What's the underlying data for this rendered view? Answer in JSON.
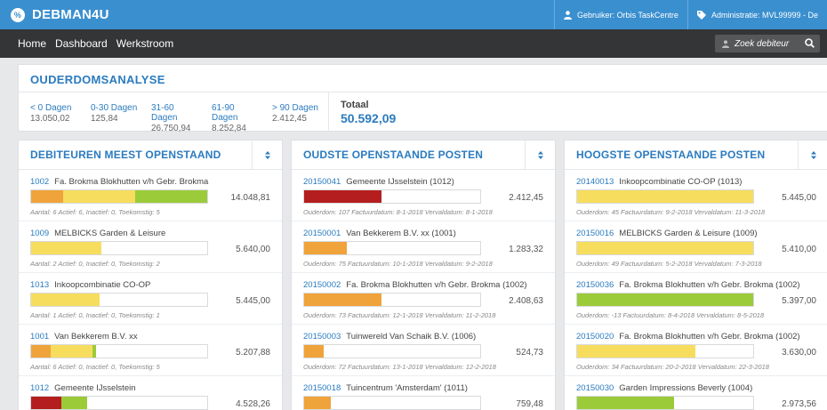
{
  "app": {
    "title": "DEBMAN4U",
    "logo_glyph": "%"
  },
  "header": {
    "user": "Gebruiker: Orbis TaskCentre",
    "administration": "Administratie: MVL99999 - De"
  },
  "nav": {
    "links": [
      "Home",
      "Dashboard",
      "Werkstroom"
    ],
    "search_placeholder": "Zoek debiteur"
  },
  "colors": {
    "accent": "#3a8fcf",
    "orange": "#f0a33a",
    "yellow": "#f7dd5e",
    "green": "#9ccb3a",
    "red": "#b51e1e"
  },
  "aging": {
    "title": "OUDERDOMSANALYSE",
    "buckets": [
      {
        "label": "< 0 Dagen",
        "value": "13.050,02"
      },
      {
        "label": "0-30 Dagen",
        "value": "125,84"
      },
      {
        "label": "31-60 Dagen",
        "value": "26.750,94"
      },
      {
        "label": "61-90 Dagen",
        "value": "8.252,84"
      },
      {
        "label": "> 90 Dagen",
        "value": "2.412,45"
      }
    ],
    "total_label": "Totaal",
    "total_value": "50.592,09"
  },
  "panels": [
    {
      "title": "DEBITEUREN MEEST OPENSTAAND",
      "rows": [
        {
          "code": "1002",
          "name": "Fa. Brokma Blokhutten v/h Gebr. Brokma",
          "amount": "14.048,81",
          "meta": "Aantal: 6 Actief: 6, Inactief: 0, Toekomstig: 5",
          "bar": [
            {
              "color": "orange",
              "pct": 18
            },
            {
              "color": "yellow",
              "pct": 41
            },
            {
              "color": "green",
              "pct": 41
            }
          ]
        },
        {
          "code": "1009",
          "name": "MELBICKS Garden & Leisure",
          "amount": "5.640,00",
          "meta": "Aantal: 2 Actief: 0, Inactief: 0, Toekomstig: 2",
          "bar": [
            {
              "color": "yellow",
              "pct": 40
            }
          ]
        },
        {
          "code": "1013",
          "name": "Inkoopcombinatie CO-OP",
          "amount": "5.445,00",
          "meta": "Aantal: 1 Actief: 0, Inactief: 0, Toekomstig: 1",
          "bar": [
            {
              "color": "yellow",
              "pct": 39
            }
          ]
        },
        {
          "code": "1001",
          "name": "Van Bekkerem B.V. xx",
          "amount": "5.207,88",
          "meta": "Aantal: 6 Actief: 0, Inactief: 0, Toekomstig: 5",
          "bar": [
            {
              "color": "orange",
              "pct": 11
            },
            {
              "color": "yellow",
              "pct": 24
            },
            {
              "color": "green",
              "pct": 2
            }
          ]
        },
        {
          "code": "1012",
          "name": "Gemeente IJsselstein",
          "amount": "4.528,26",
          "meta": "Aantal: 2 Actief: 0, Inactief: 0, Toekomstig: 1",
          "bar": [
            {
              "color": "red",
              "pct": 17
            },
            {
              "color": "green",
              "pct": 15
            }
          ]
        }
      ]
    },
    {
      "title": "OUDSTE OPENSTAANDE POSTEN",
      "rows": [
        {
          "code": "20150041",
          "name": "Gemeente IJsselstein (1012)",
          "amount": "2.412,45",
          "meta": "Ouderdom: 107 Factuurdatum: 8-1-2018 Vervaldatum: 8-1-2018",
          "bar": [
            {
              "color": "red",
              "pct": 44
            }
          ]
        },
        {
          "code": "20150001",
          "name": "Van Bekkerem B.V. xx (1001)",
          "amount": "1.283,32",
          "meta": "Ouderdom: 75 Factuurdatum: 10-1-2018 Vervaldatum: 9-2-2018",
          "bar": [
            {
              "color": "orange",
              "pct": 24
            }
          ]
        },
        {
          "code": "20150002",
          "name": "Fa. Brokma Blokhutten v/h Gebr. Brokma (1002)",
          "amount": "2.408,63",
          "meta": "Ouderdom: 73 Factuurdatum: 12-1-2018 Vervaldatum: 11-2-2018",
          "bar": [
            {
              "color": "orange",
              "pct": 44
            }
          ]
        },
        {
          "code": "20150003",
          "name": "Tuinwereld Van Schaik B.V. (1006)",
          "amount": "524,73",
          "meta": "Ouderdom: 72 Factuurdatum: 13-1-2018 Vervaldatum: 12-2-2018",
          "bar": [
            {
              "color": "orange",
              "pct": 11
            }
          ]
        },
        {
          "code": "20150018",
          "name": "Tuincentrum 'Amsterdam' (1011)",
          "amount": "759,48",
          "meta": "Ouderdom: 70 Factuurdatum: 15-1-2018 Vervaldatum: 14-2-2018",
          "bar": [
            {
              "color": "orange",
              "pct": 15
            }
          ]
        }
      ]
    },
    {
      "title": "HOOGSTE OPENSTAANDE POSTEN",
      "rows": [
        {
          "code": "20140013",
          "name": "Inkoopcombinatie CO-OP (1013)",
          "amount": "5.445,00",
          "meta": "Ouderdom: 45 Factuurdatum: 9-2-2018 Vervaldatum: 11-3-2018",
          "bar": [
            {
              "color": "yellow",
              "pct": 100
            }
          ]
        },
        {
          "code": "20150016",
          "name": "MELBICKS Garden & Leisure (1009)",
          "amount": "5.410,00",
          "meta": "Ouderdom: 49 Factuurdatum: 5-2-2018 Vervaldatum: 7-3-2018",
          "bar": [
            {
              "color": "yellow",
              "pct": 100
            }
          ]
        },
        {
          "code": "20150036",
          "name": "Fa. Brokma Blokhutten v/h Gebr. Brokma (1002)",
          "amount": "5.397,00",
          "meta": "Ouderdom: -13 Factuurdatum: 8-4-2018 Vervaldatum: 8-5-2018",
          "bar": [
            {
              "color": "green",
              "pct": 100
            }
          ]
        },
        {
          "code": "20150020",
          "name": "Fa. Brokma Blokhutten v/h Gebr. Brokma (1002)",
          "amount": "3.630,00",
          "meta": "Ouderdom: 34 Factuurdatum: 20-2-2018 Vervaldatum: 22-3-2018",
          "bar": [
            {
              "color": "yellow",
              "pct": 67
            }
          ]
        },
        {
          "code": "20150030",
          "name": "Garden Impressions Beverly (1004)",
          "amount": "2.973,56",
          "meta": "Ouderdom: -7 Factuurdatum: 2-4-2018 Vervaldatum: 2-5-2018",
          "bar": [
            {
              "color": "green",
              "pct": 55
            }
          ]
        }
      ]
    }
  ]
}
